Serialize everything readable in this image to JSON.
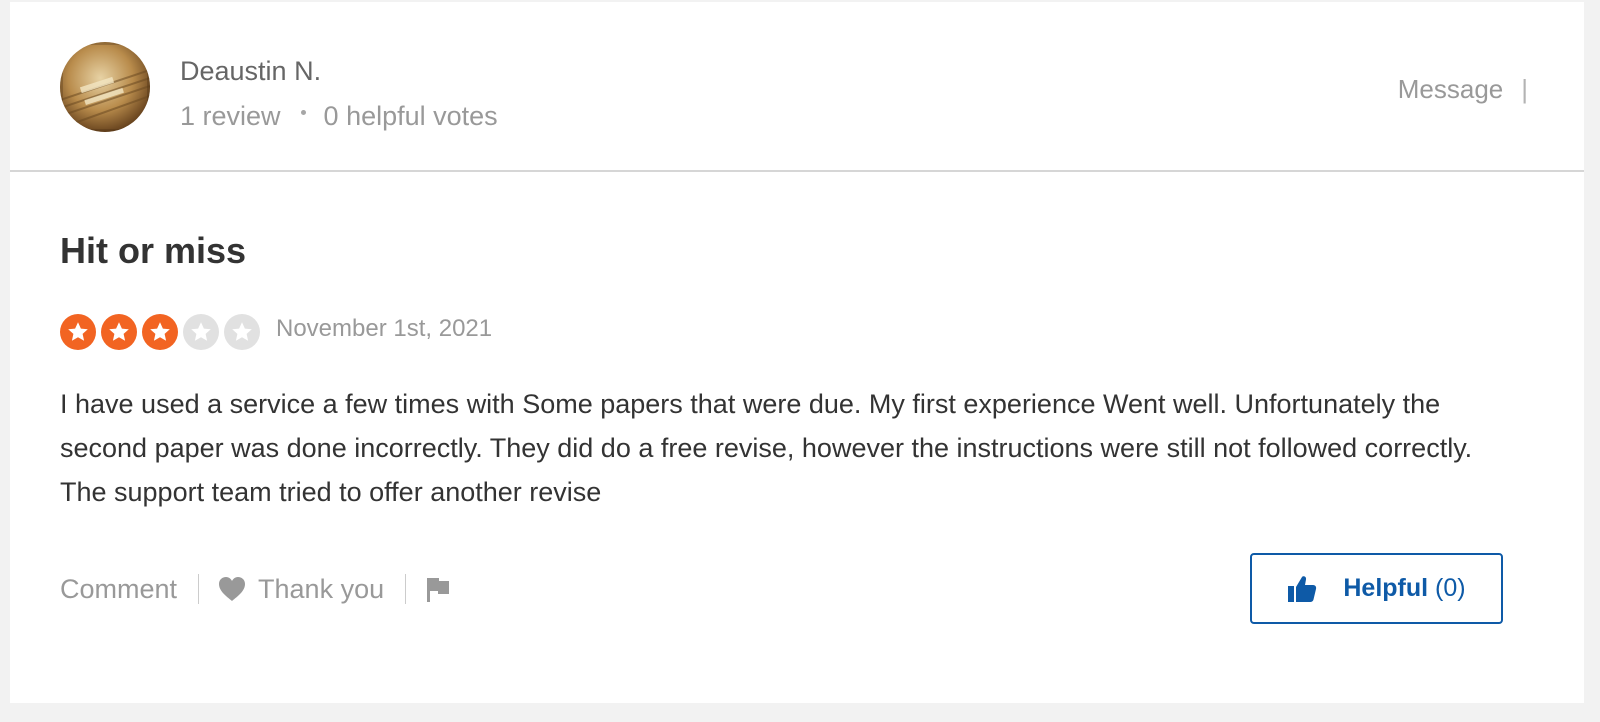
{
  "user": {
    "name": "Deaustin N.",
    "reviews": "1 review",
    "helpful_votes": "0 helpful votes",
    "avatar_icon": "avatar-photo"
  },
  "header_actions": {
    "message": "Message",
    "separator": "|"
  },
  "review": {
    "title": "Hit or miss",
    "rating": 3,
    "rating_max": 5,
    "date": "November 1st, 2021",
    "body": "I have used a service a few times with Some papers that were due. My first experience Went well. Unfortunately the second paper was done incorrectly. They did do a free revise, however the instructions were still not followed correctly. The support team tried to offer another revise"
  },
  "actions": {
    "comment": "Comment",
    "thank_you": "Thank you",
    "thank_icon": "heart-icon",
    "flag_icon": "flag-icon"
  },
  "helpful": {
    "label": "Helpful",
    "count": "(0)",
    "icon": "thumbs-up-icon"
  },
  "colors": {
    "star_on": "#f26422",
    "star_off": "#e1e1e1",
    "accent": "#0e5aa7"
  }
}
